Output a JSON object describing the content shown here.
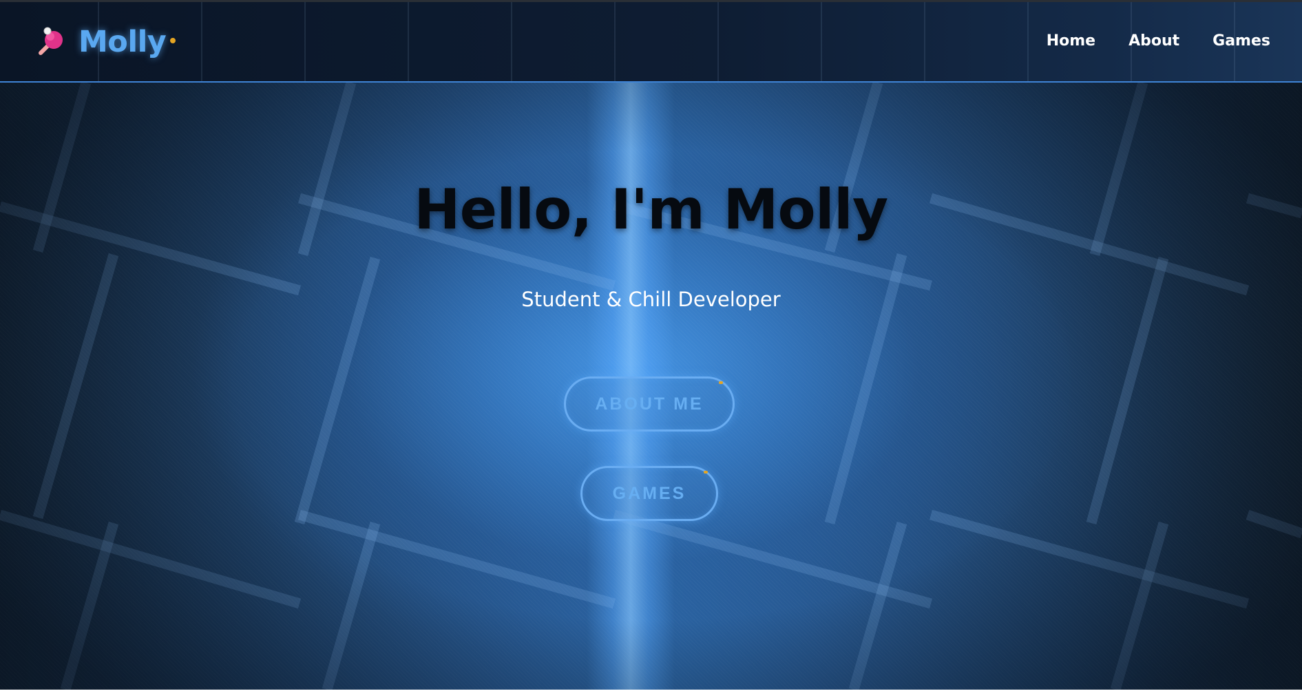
{
  "navbar": {
    "brand": "Molly",
    "brand_icon": "ping-pong-paddle-icon",
    "links": [
      "Home",
      "About",
      "Games"
    ]
  },
  "hero": {
    "title": "Hello, I'm Molly",
    "subtitle": "Student & Chill Developer",
    "buttons": [
      "ABOUT ME",
      "GAMES"
    ]
  },
  "colors": {
    "accent": "#5aa8f0",
    "spark": "#e5a523",
    "nav_background": "#0a1526",
    "nav_border": "#3f84d6",
    "hero_center": "#5aa7f2",
    "title_text": "#060a10"
  }
}
